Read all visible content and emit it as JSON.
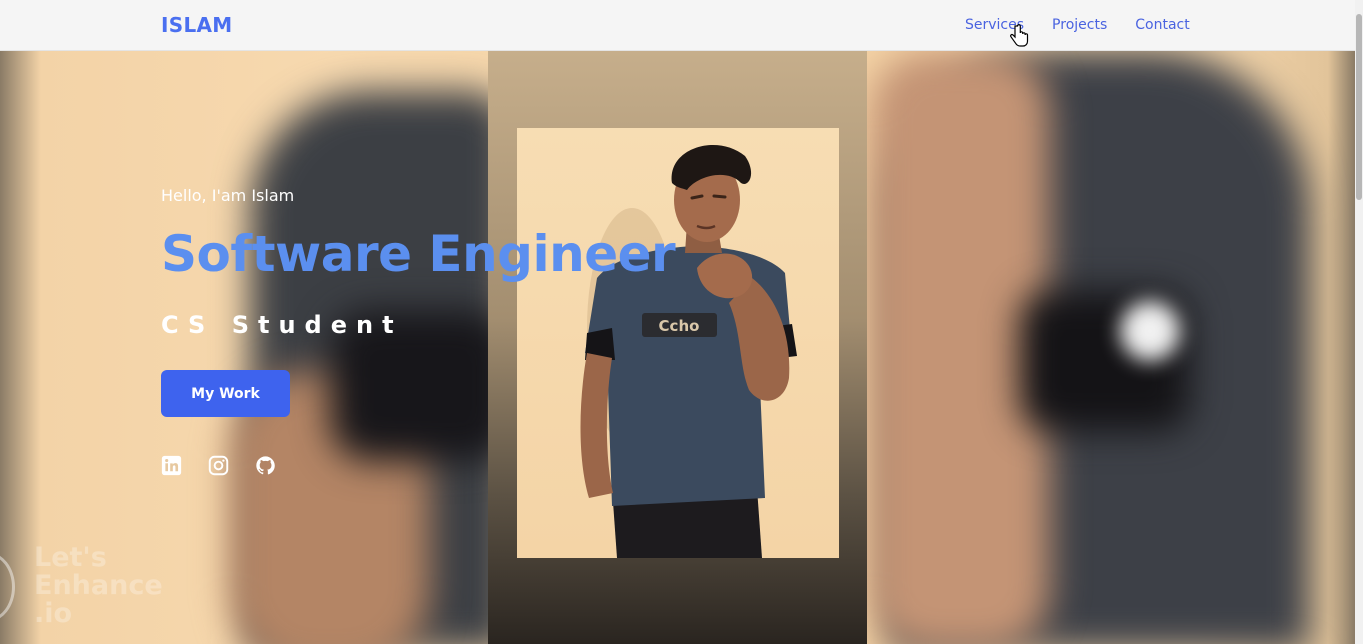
{
  "header": {
    "logo": "ISLAM",
    "nav": [
      {
        "label": "Services"
      },
      {
        "label": "Projects"
      },
      {
        "label": "Contact"
      }
    ]
  },
  "hero": {
    "greeting": "Hello, I'am Islam",
    "title": "Software Engineer",
    "subtitle": "CS Student",
    "cta_label": "My Work",
    "socials": [
      {
        "icon": "linkedin-icon"
      },
      {
        "icon": "instagram-icon"
      },
      {
        "icon": "github-icon"
      }
    ]
  },
  "watermark": {
    "text": "Let's Enhance .io"
  },
  "colors": {
    "accent": "#3e63ee",
    "title": "#5b8fef",
    "logo": "#4a6ff0"
  }
}
